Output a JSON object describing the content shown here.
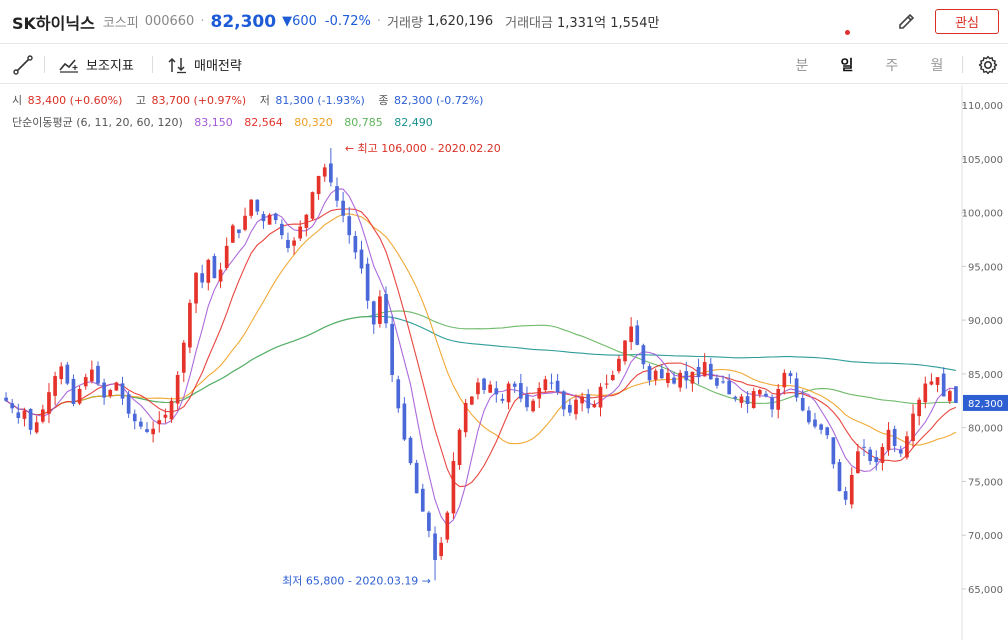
{
  "header": {
    "name": "SK하이닉스",
    "market": "코스피",
    "code": "000660",
    "price": "82,300",
    "change": "▼600",
    "change_rate": "-0.72%",
    "volume_label": "거래량",
    "volume": "1,620,196",
    "amount_label": "거래대금",
    "amount": "1,331억 1,554만",
    "favorite_label": "관심",
    "colors": {
      "up": "#d93025",
      "down": "#2d5fd3"
    }
  },
  "toolbar": {
    "indicator_label": "보조지표",
    "strategy_label": "매매전략",
    "periods": [
      "분",
      "일",
      "주",
      "월"
    ],
    "active_period": "일",
    "icons": [
      "draw-line-icon",
      "indicator-icon",
      "strategy-icon",
      "settings-icon"
    ]
  },
  "ohlc": {
    "open_label": "시",
    "open": "83,400 (+0.60%)",
    "high_label": "고",
    "high": "83,700 (+0.97%)",
    "low_label": "저",
    "low": "81,300 (-1.93%)",
    "close_label": "종",
    "close": "82,300 (-0.72%)"
  },
  "ma_legend": {
    "label": "단순이동평균 (6, 11, 20, 60, 120)",
    "values": [
      {
        "value": "83,150",
        "color": "#a45ad8"
      },
      {
        "value": "82,564",
        "color": "#e5322b"
      },
      {
        "value": "80,320",
        "color": "#f0a020"
      },
      {
        "value": "80,785",
        "color": "#5fb45a"
      },
      {
        "value": "82,490",
        "color": "#17928e"
      }
    ]
  },
  "chart_data": {
    "type": "candlestick",
    "y_axis": {
      "min": 62000,
      "max": 112000,
      "ticks": [
        "110,000",
        "105,000",
        "100,000",
        "95,000",
        "90,000",
        "85,000",
        "80,000",
        "75,000",
        "70,000",
        "65,000"
      ],
      "side": "right"
    },
    "last_price_label": "82,300",
    "annotations": {
      "high": "← 최고 106,000 - 2020.02.20",
      "low": "최저 65,800 - 2020.03.19 →"
    },
    "candle_colors": {
      "up": "#e5322b",
      "down": "#4a68d8"
    },
    "closes": [
      82500,
      81800,
      80900,
      81600,
      79800,
      80500,
      81700,
      83300,
      84800,
      85700,
      84100,
      82200,
      83600,
      84700,
      85400,
      84100,
      82800,
      83500,
      84200,
      82700,
      81300,
      80600,
      80100,
      79600,
      79900,
      80700,
      81200,
      82500,
      84900,
      87900,
      91600,
      94400,
      93500,
      95600,
      93900,
      94700,
      96900,
      98800,
      98100,
      99700,
      101200,
      100100,
      99200,
      99800,
      99300,
      97900,
      96700,
      97400,
      98700,
      99800,
      101900,
      103400,
      104200,
      102800,
      101100,
      99700,
      97900,
      96300,
      94800,
      91800,
      89600,
      92200,
      89700,
      84900,
      81800,
      78900,
      76700,
      73900,
      72200,
      70400,
      67700,
      69300,
      72100,
      76900,
      79800,
      82300,
      82900,
      84200,
      83500,
      84000,
      83100,
      82500,
      84100,
      83800,
      82700,
      81900,
      82500,
      83700,
      84500,
      84100,
      83300,
      81700,
      81400,
      82600,
      82900,
      81800,
      82200,
      83800,
      84100,
      84900,
      86400,
      88100,
      89400,
      87700,
      85900,
      84400,
      85300,
      84600,
      85100,
      84100,
      85100,
      84400,
      85200,
      84700,
      86100,
      84500,
      83900,
      84200,
      83100,
      82700,
      82900,
      82200,
      83400,
      83500,
      82900,
      81700,
      83600,
      85100,
      84800,
      82800,
      81600,
      80500,
      80100,
      79800,
      79300,
      76600,
      74100,
      73300,
      75600,
      77800,
      78200,
      76900,
      76800,
      78200,
      79800,
      78300,
      77600,
      79200,
      81300,
      82600,
      84100,
      84300,
      84700,
      82900,
      83400,
      82300
    ]
  }
}
